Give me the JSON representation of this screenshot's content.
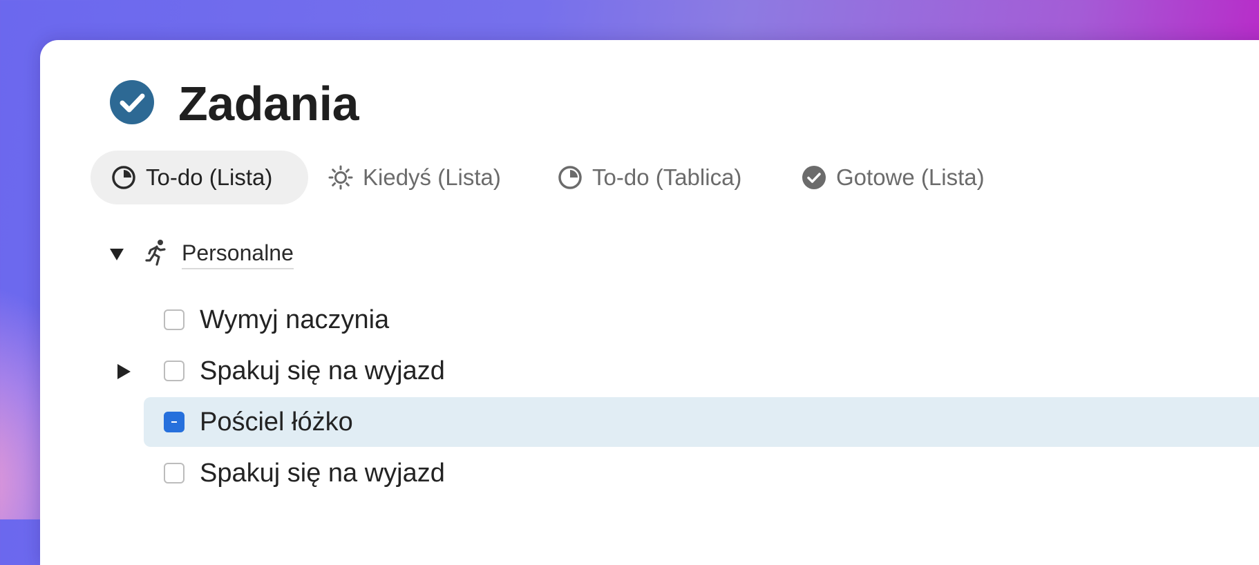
{
  "header": {
    "title": "Zadania",
    "icon": "check-circle-icon",
    "icon_color": "#2d6994"
  },
  "tabs": [
    {
      "label": "To-do (Lista)",
      "icon": "half-circle-icon",
      "active": true
    },
    {
      "label": "Kiedyś (Lista)",
      "icon": "sun-icon",
      "active": false
    },
    {
      "label": "To-do (Tablica)",
      "icon": "half-circle-icon",
      "active": false
    },
    {
      "label": "Gotowe (Lista)",
      "icon": "check-circle-icon",
      "active": false
    }
  ],
  "group": {
    "title": "Personalne",
    "icon": "running-person-icon",
    "expanded": true
  },
  "tasks": [
    {
      "label": "Wymyj naczynia",
      "state": "unchecked",
      "has_subtasks": false
    },
    {
      "label": "Spakuj się na wyjazd",
      "state": "unchecked",
      "has_subtasks": true
    },
    {
      "label": "Pościel łóżko",
      "state": "indeterminate",
      "selected": true,
      "has_subtasks": false
    },
    {
      "label": "Spakuj się na wyjazd",
      "state": "unchecked",
      "has_subtasks": false
    }
  ],
  "colors": {
    "accent": "#2670dc",
    "selected_row": "#e1edf4",
    "active_tab_bg": "#efefef"
  }
}
